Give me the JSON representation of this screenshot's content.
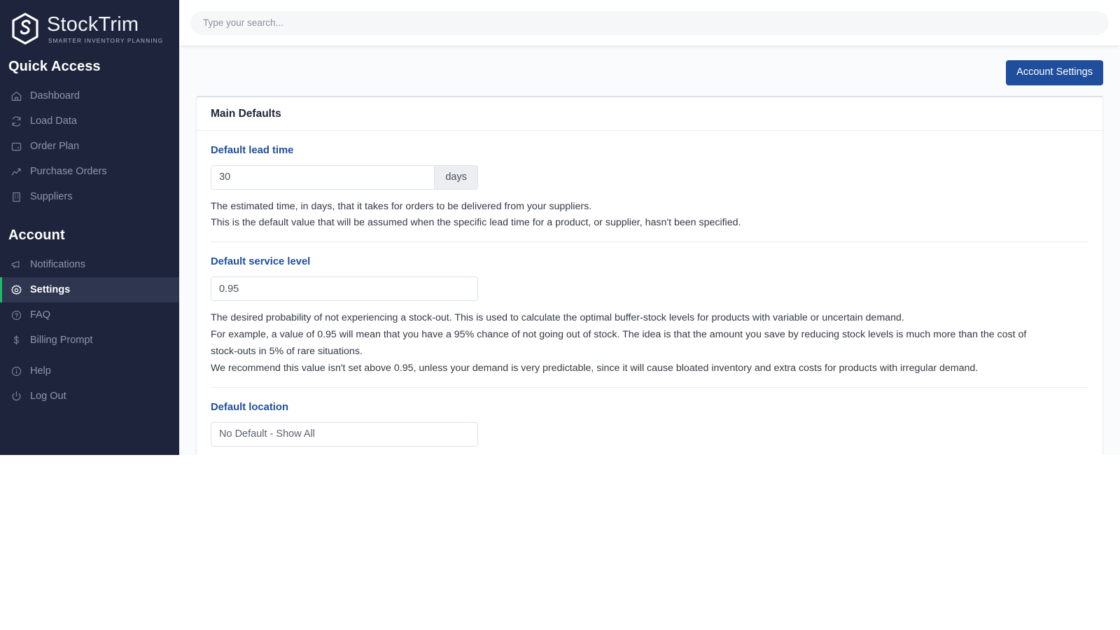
{
  "brand": {
    "name": "StockTrim",
    "tagline": "SMARTER INVENTORY PLANNING",
    "logo_icon": "stocktrim-hexagon-logo"
  },
  "sidebar": {
    "quick_access_heading": "Quick Access",
    "account_heading": "Account",
    "quick_access_items": [
      {
        "label": "Dashboard",
        "icon": "home-icon"
      },
      {
        "label": "Load Data",
        "icon": "refresh-icon"
      },
      {
        "label": "Order Plan",
        "icon": "clipboard-icon"
      },
      {
        "label": "Purchase Orders",
        "icon": "chart-line-icon"
      },
      {
        "label": "Suppliers",
        "icon": "building-icon"
      }
    ],
    "account_items": [
      {
        "label": "Notifications",
        "icon": "megaphone-icon"
      },
      {
        "label": "Settings",
        "icon": "gear-icon"
      },
      {
        "label": "FAQ",
        "icon": "question-circle-icon"
      },
      {
        "label": "Billing Prompt",
        "icon": "dollar-icon"
      },
      {
        "label": "Help",
        "icon": "info-circle-icon"
      },
      {
        "label": "Log Out",
        "icon": "power-icon"
      }
    ],
    "active_item": "Settings",
    "accent_color": "#1bbd6b",
    "background_color": "#1e243c"
  },
  "topbar": {
    "search_placeholder": "Type your search...",
    "search_value": ""
  },
  "actions": {
    "account_settings_label": "Account Settings",
    "primary_color": "#1f4e9c"
  },
  "card": {
    "title": "Main Defaults",
    "fields": [
      {
        "label": "Default lead time",
        "value": "30",
        "unit": "days",
        "help": [
          "The estimated time, in days, that it takes for orders to be delivered from your suppliers.",
          "This is the default value that will be assumed when the specific lead time for a product, or supplier, hasn't been specified."
        ]
      },
      {
        "label": "Default service level",
        "value": "0.95",
        "help": [
          "The desired probability of not experiencing a stock-out. This is used to calculate the optimal buffer-stock levels for products with variable or uncertain demand.",
          "For example, a value of 0.95 will mean that you have a 95% chance of not going out of stock. The idea is that the amount you save by reducing stock levels is much more than the cost of stock-outs in 5% of rare situations.",
          "We recommend this value isn't set above 0.95, unless your demand is very predictable, since it will cause bloated inventory and extra costs for products with irregular demand."
        ]
      },
      {
        "label": "Default location",
        "value": "No Default - Show All",
        "help": []
      }
    ]
  }
}
